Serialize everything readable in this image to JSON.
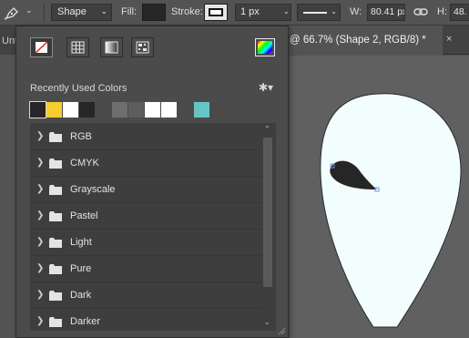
{
  "options_bar": {
    "tool_icon": "pen-icon",
    "mode": "Shape",
    "fill_label": "Fill:",
    "fill_color": "#262626",
    "stroke_label": "Stroke:",
    "stroke_width": "1 px",
    "width_label": "W:",
    "width_value": "80.41 px",
    "link_icon": "link-icon",
    "height_label": "H:",
    "height_value": "48."
  },
  "tabs": {
    "left_tab": "Unti",
    "active_tab": "@ 66.7% (Shape 2, RGB/8) *",
    "close": "×"
  },
  "swatches_panel": {
    "fill_types": [
      "no-color-icon",
      "solid-color-icon",
      "gradient-icon",
      "pattern-icon"
    ],
    "recent_title": "Recently Used Colors",
    "gear_icon": "gear-icon",
    "recent_colors": [
      "#262626",
      "#f7ce2b",
      "#ffffff",
      "#262626",
      "#4a4a4a",
      "#6e6e6e",
      "#5d5d5d",
      "#ffffff",
      "#ffffff",
      "#4a4a4a",
      "#66c5c4",
      "#4a4a4a",
      "#4a4a4a",
      "#4a4a4a",
      "#4a4a4a"
    ],
    "folders": [
      {
        "label": "RGB"
      },
      {
        "label": "CMYK"
      },
      {
        "label": "Grayscale"
      },
      {
        "label": "Pastel"
      },
      {
        "label": "Light"
      },
      {
        "label": "Pure"
      },
      {
        "label": "Dark"
      },
      {
        "label": "Darker"
      }
    ]
  },
  "canvas": {
    "shape_fill": "#f2fefd",
    "eye_fill": "#262626"
  }
}
